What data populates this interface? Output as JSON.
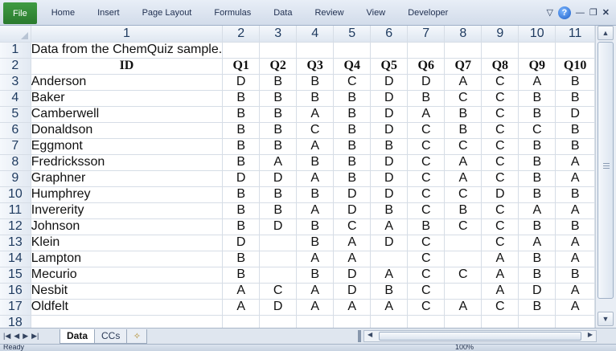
{
  "ribbon": {
    "file": "File",
    "tabs": [
      "Home",
      "Insert",
      "Page Layout",
      "Formulas",
      "Data",
      "Review",
      "View",
      "Developer"
    ],
    "help": "?"
  },
  "grid": {
    "col_headers": [
      "1",
      "2",
      "3",
      "4",
      "5",
      "6",
      "7",
      "8",
      "9",
      "10",
      "11"
    ],
    "title_row": {
      "row": "1",
      "text": "Data from the ChemQuiz sample."
    },
    "header_row": {
      "row": "2",
      "cells": [
        "ID",
        "Q1",
        "Q2",
        "Q3",
        "Q4",
        "Q5",
        "Q6",
        "Q7",
        "Q8",
        "Q9",
        "Q10"
      ]
    },
    "rows": [
      {
        "row": "3",
        "cells": [
          "Anderson",
          "D",
          "B",
          "B",
          "C",
          "D",
          "D",
          "A",
          "C",
          "A",
          "B"
        ]
      },
      {
        "row": "4",
        "cells": [
          "Baker",
          "B",
          "B",
          "B",
          "B",
          "D",
          "B",
          "C",
          "C",
          "B",
          "B"
        ]
      },
      {
        "row": "5",
        "cells": [
          "Camberwell",
          "B",
          "B",
          "A",
          "B",
          "D",
          "A",
          "B",
          "C",
          "B",
          "D"
        ]
      },
      {
        "row": "6",
        "cells": [
          "Donaldson",
          "B",
          "B",
          "C",
          "B",
          "D",
          "C",
          "B",
          "C",
          "C",
          "B"
        ]
      },
      {
        "row": "7",
        "cells": [
          "Eggmont",
          "B",
          "B",
          "A",
          "B",
          "B",
          "C",
          "C",
          "C",
          "B",
          "B"
        ]
      },
      {
        "row": "8",
        "cells": [
          "Fredricksson",
          "B",
          "A",
          "B",
          "B",
          "D",
          "C",
          "A",
          "C",
          "B",
          "A"
        ]
      },
      {
        "row": "9",
        "cells": [
          "Graphner",
          "D",
          "D",
          "A",
          "B",
          "D",
          "C",
          "A",
          "C",
          "B",
          "A"
        ]
      },
      {
        "row": "10",
        "cells": [
          "Humphrey",
          "B",
          "B",
          "B",
          "D",
          "D",
          "C",
          "C",
          "D",
          "B",
          "B"
        ]
      },
      {
        "row": "11",
        "cells": [
          "Invererity",
          "B",
          "B",
          "A",
          "D",
          "B",
          "C",
          "B",
          "C",
          "A",
          "A"
        ]
      },
      {
        "row": "12",
        "cells": [
          "Johnson",
          "B",
          "D",
          "B",
          "C",
          "A",
          "B",
          "C",
          "C",
          "B",
          "B"
        ]
      },
      {
        "row": "13",
        "cells": [
          "Klein",
          "D",
          "",
          "B",
          "A",
          "D",
          "C",
          "",
          "C",
          "A",
          "A"
        ]
      },
      {
        "row": "14",
        "cells": [
          "Lampton",
          "B",
          "",
          "A",
          "A",
          "",
          "C",
          "",
          "A",
          "B",
          "A"
        ]
      },
      {
        "row": "15",
        "cells": [
          "Mecurio",
          "B",
          "",
          "B",
          "D",
          "A",
          "C",
          "C",
          "A",
          "B",
          "B"
        ]
      },
      {
        "row": "16",
        "cells": [
          "Nesbit",
          "A",
          "C",
          "A",
          "D",
          "B",
          "C",
          "",
          "A",
          "D",
          "A"
        ]
      },
      {
        "row": "17",
        "cells": [
          "Oldfelt",
          "A",
          "D",
          "A",
          "A",
          "A",
          "C",
          "A",
          "C",
          "B",
          "A"
        ]
      }
    ],
    "last_row": "18"
  },
  "sheets": {
    "tabs": [
      "Data",
      "CCs"
    ],
    "active": "Data"
  },
  "status": {
    "text": "Ready",
    "zoom": "100%"
  }
}
